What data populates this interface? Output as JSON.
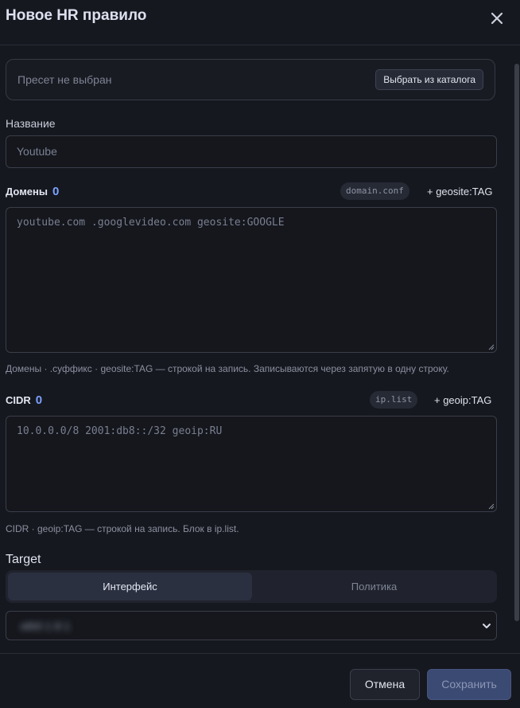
{
  "dialog": {
    "title": "Новое HR правило"
  },
  "preset": {
    "placeholder": "Пресет не выбран",
    "catalog_button": "Выбрать из каталога"
  },
  "name_field": {
    "label": "Название",
    "placeholder": "Youtube"
  },
  "domains": {
    "title": "Домены",
    "count": "0",
    "file_chip": "domain.conf",
    "add_link": "+ geosite:TAG",
    "placeholder": "youtube.com .googlevideo.com geosite:GOOGLE",
    "hint": "Домены · .суффикс · geosite:TAG — строкой на запись. Записываются через запятую в одну строку."
  },
  "cidr": {
    "title": "CIDR",
    "count": "0",
    "file_chip": "ip.list",
    "add_link": "+ geoip:TAG",
    "placeholder": "10.0.0.0/8 2001:db8::/32 geoip:RU",
    "hint": "CIDR · geoip:TAG — строкой на запись. Блок в ip.list."
  },
  "target": {
    "label": "Target",
    "tabs": [
      {
        "label": "Интерфейс",
        "active": true
      },
      {
        "label": "Политика",
        "active": false
      }
    ],
    "select_value": "eth0 1 8 1"
  },
  "footer": {
    "cancel": "Отмена",
    "save": "Сохранить"
  },
  "colors": {
    "background": "#16181f",
    "accent": "#7aa2ff",
    "primary_button": "#3b4a72"
  },
  "icons": {
    "close": "close-icon",
    "dropdown": "chevron-down-icon"
  }
}
